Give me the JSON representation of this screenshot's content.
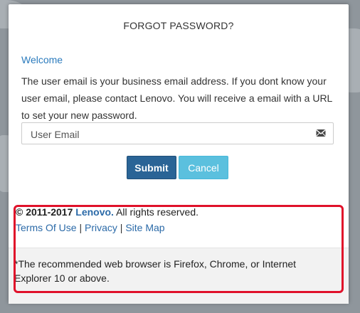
{
  "dialog": {
    "title": "FORGOT PASSWORD?",
    "welcome": "Welcome",
    "description": "The user email is your business email address. If you dont know your user email, please contact Lenovo. You will receive a email with a URL to set your new password.",
    "email_placeholder": "User Email",
    "email_value": "",
    "submit_label": "Submit",
    "cancel_label": "Cancel"
  },
  "footer": {
    "copyright_prefix": "© 2011-2017",
    "brand": "Lenovo.",
    "rights": "All rights reserved.",
    "links": [
      "Terms Of Use",
      "Privacy",
      "Site Map"
    ],
    "separator": "|",
    "browser_note": "*The recommended web browser is Firefox, Chrome, or Internet Explorer 10 or above."
  },
  "colors": {
    "accent": "#2b7bbd",
    "submit_bg": "#2a6496",
    "cancel_bg": "#5bc0de",
    "highlight": "#e0112a"
  },
  "icons": {
    "email_field": "envelope-icon"
  }
}
